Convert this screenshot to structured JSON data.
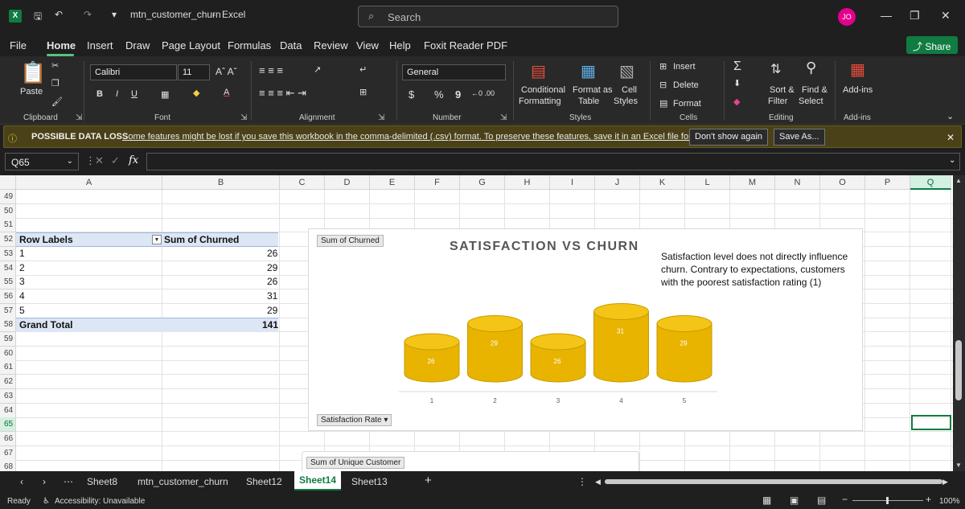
{
  "window": {
    "doc_title": "mtn_customer_churn",
    "app_name": "Excel",
    "search_placeholder": "Search",
    "avatar_initials": "JO",
    "share_label": "Share"
  },
  "menu": [
    "File",
    "Home",
    "Insert",
    "Draw",
    "Page Layout",
    "Formulas",
    "Data",
    "Review",
    "View",
    "Help",
    "Foxit Reader PDF"
  ],
  "ribbon": {
    "paste": "Paste",
    "clipboard": "Clipboard",
    "font_name": "Calibri",
    "font_size": "11",
    "font_group": "Font",
    "alignment_group": "Alignment",
    "number_format": "General",
    "number_group": "Number",
    "conditional": "Conditional",
    "formatting": "Formatting",
    "format_as": "Format as",
    "table": "Table",
    "cell": "Cell",
    "styles_lbl": "Styles",
    "styles_group": "Styles",
    "insert": "Insert",
    "delete": "Delete",
    "format": "Format",
    "cells_group": "Cells",
    "sort": "Sort &",
    "filter": "Filter",
    "find": "Find &",
    "select": "Select",
    "editing_group": "Editing",
    "addins": "Add-ins",
    "addins_group": "Add-ins",
    "percent": "%",
    "dollar": "$",
    "comma": "9",
    "inc_dec": "←0 .00",
    "dec_dec": ".00 →0"
  },
  "warning": {
    "title": "POSSIBLE DATA LOSS",
    "message": "Some features might be lost if you save this workbook in the comma-delimited (.csv) format. To preserve these features, save it in an Excel file format.",
    "dont_show": "Don't show again",
    "save_as": "Save As..."
  },
  "formula_bar": {
    "name_box": "Q65",
    "fx": "fx",
    "value": ""
  },
  "columns": [
    "A",
    "B",
    "C",
    "D",
    "E",
    "F",
    "G",
    "H",
    "I",
    "J",
    "K",
    "L",
    "M",
    "N",
    "O",
    "P",
    "Q"
  ],
  "rows": [
    "49",
    "50",
    "51",
    "52",
    "53",
    "54",
    "55",
    "56",
    "57",
    "58",
    "59",
    "60",
    "61",
    "62",
    "63",
    "64",
    "65",
    "66",
    "67",
    "68"
  ],
  "pivot": {
    "header_row_labels": "Row Labels",
    "header_sum": "Sum of Churned",
    "rows": [
      {
        "label": "1",
        "value": "26"
      },
      {
        "label": "2",
        "value": "29"
      },
      {
        "label": "3",
        "value": "26"
      },
      {
        "label": "4",
        "value": "31"
      },
      {
        "label": "5",
        "value": "29"
      }
    ],
    "total_label": "Grand Total",
    "total_value": "141"
  },
  "chart": {
    "field_sum": "Sum of Churned",
    "field_axis": "Satisfaction Rate",
    "title": "SATISFACTION VS CHURN",
    "note": "Satisfaction level does not directly influence churn. Contrary to expectations, customers with the poorest satisfaction rating (1)",
    "bar_color": "#e8b400",
    "bar_top_color": "#f4c417"
  },
  "chart_data": {
    "type": "bar",
    "title": "SATISFACTION VS CHURN",
    "categories": [
      "1",
      "2",
      "3",
      "4",
      "5"
    ],
    "values": [
      26,
      29,
      26,
      31,
      29
    ],
    "xlabel": "",
    "ylabel": "",
    "grid": false
  },
  "chart2": {
    "field": "Sum of Unique Customer"
  },
  "tabs": [
    "Sheet8",
    "mtn_customer_churn",
    "Sheet12",
    "Sheet14",
    "Sheet13"
  ],
  "tabs_active": "Sheet14",
  "status": {
    "ready": "Ready",
    "accessibility": "Accessibility: Unavailable",
    "zoom": "100%"
  }
}
